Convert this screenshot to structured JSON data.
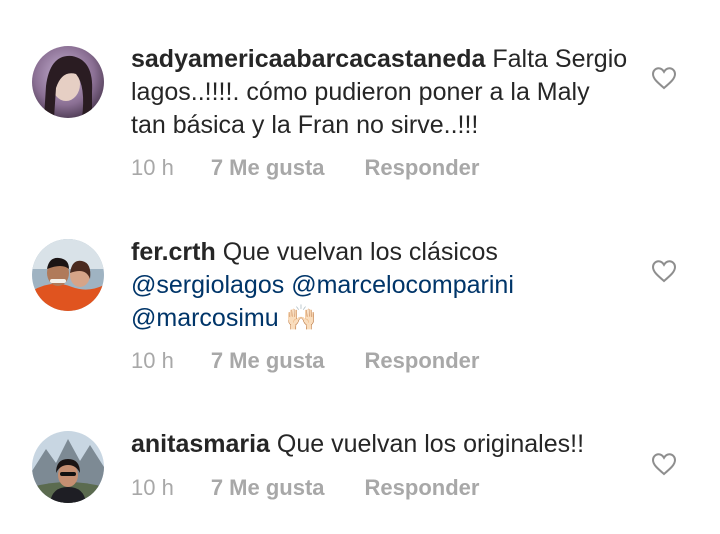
{
  "comments": [
    {
      "username": "sadyamericaabarcacastaneda",
      "text": " Falta Sergio lagos..!!!!. cómo pudieron poner a la Maly tan básica y la Fran no sirve..!!!",
      "time": "10 h",
      "likes": "7 Me gusta",
      "reply": "Responder"
    },
    {
      "username": "fer.crth",
      "text": " Que vuelvan los clásicos ",
      "mentions": [
        "@sergiolagos",
        "@marcelocomparini",
        "@marcosimu"
      ],
      "emoji": "🙌🏻",
      "time": "10 h",
      "likes": "7 Me gusta",
      "reply": "Responder"
    },
    {
      "username": "anitasmaria",
      "text": " Que vuelvan los originales!!",
      "time": "10 h",
      "likes": "7 Me gusta",
      "reply": "Responder"
    }
  ],
  "icons": {
    "like": "heart-outline-icon"
  },
  "colors": {
    "text": "#262626",
    "mention": "#003569",
    "meta": "#a8a8a8"
  }
}
